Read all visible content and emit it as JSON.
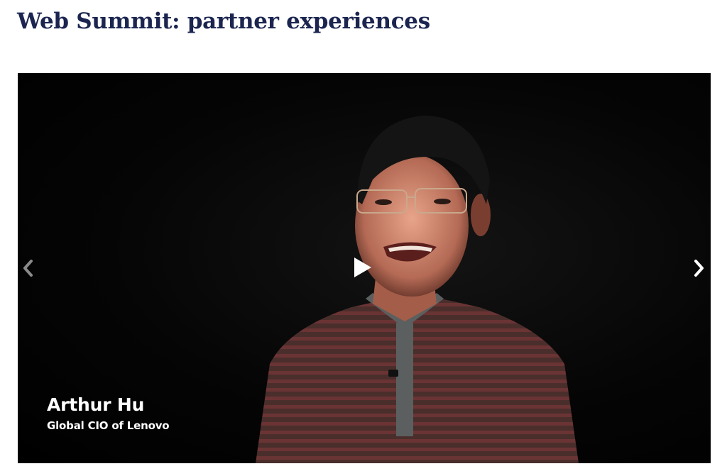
{
  "page": {
    "title": "Web Summit: partner experiences"
  },
  "video": {
    "speaker_name": "Arthur Hu",
    "speaker_role": "Global CIO of Lenovo"
  },
  "icons": {
    "play": "play-icon",
    "previous": "chevron-left-icon",
    "next": "chevron-right-icon"
  },
  "colors": {
    "title": "#1b2550",
    "video_background": "#000000",
    "caption_text": "#ffffff",
    "arrow_inactive": "#8a8a8a",
    "arrow_active": "#ffffff"
  }
}
